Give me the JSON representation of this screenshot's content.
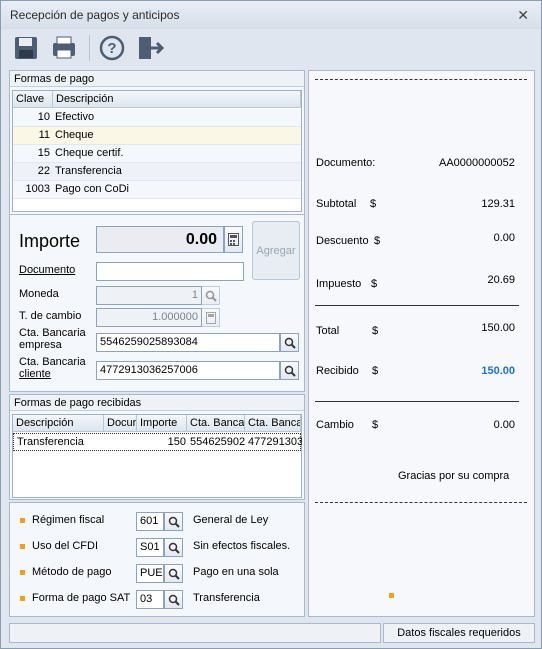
{
  "window": {
    "title": "Recepción de pagos y anticipos"
  },
  "toolbar": {
    "icons": [
      "save-icon",
      "print-icon",
      "help-icon",
      "exit-icon"
    ]
  },
  "formas_pago": {
    "header": "Formas de pago",
    "columns": [
      "Clave",
      "Descripción"
    ],
    "rows": [
      {
        "clave": "10",
        "desc": "Efectivo"
      },
      {
        "clave": "11",
        "desc": "Cheque"
      },
      {
        "clave": "15",
        "desc": "Cheque certif."
      },
      {
        "clave": "22",
        "desc": "Transferencia"
      },
      {
        "clave": "1003",
        "desc": "Pago con CoDi"
      }
    ]
  },
  "form": {
    "importe_label": "Importe",
    "importe_value": "0.00",
    "agregar": "Agregar",
    "documento_label": "Documento",
    "documento_value": "",
    "moneda_label": "Moneda",
    "moneda_value": "1",
    "tcambio_label": "T. de cambio",
    "tcambio_value": "1.000000",
    "cta_empresa_label1": "Cta. Bancaria",
    "cta_empresa_label2": "empresa",
    "cta_empresa_value": "5546259025893084",
    "cta_cliente_label1": "Cta. Bancaria",
    "cta_cliente_label2": "cliente",
    "cta_cliente_value": "4772913036257006"
  },
  "recibidas": {
    "header": "Formas de pago recibidas",
    "columns": [
      "Descripción",
      "Docur",
      "Importe",
      "Cta. Banca",
      "Cta. Banca"
    ],
    "rows": [
      {
        "desc": "Transferencia",
        "doc": "",
        "importe": "150",
        "cta1": "554625902",
        "cta2": "477291303"
      }
    ]
  },
  "fiscal": [
    {
      "label": "Régimen fiscal",
      "code": "601",
      "desc": "General de Ley"
    },
    {
      "label": "Uso del CFDI",
      "code": "S01",
      "desc": "Sin efectos fiscales."
    },
    {
      "label": "Método de pago",
      "code": "PUE",
      "desc": "Pago en una sola"
    },
    {
      "label": "Forma de pago SAT",
      "code": "03",
      "desc": "Transferencia"
    }
  ],
  "receipt": {
    "documento_label": "Documento:",
    "documento_value": "AA0000000052",
    "subtotal_label": "Subtotal",
    "subtotal_value": "129.31",
    "descuento_label": "Descuento",
    "descuento_value": "0.00",
    "impuesto_label": "Impuesto",
    "impuesto_value": "20.69",
    "total_label": "Total",
    "total_value": "150.00",
    "recibido_label": "Recibido",
    "recibido_value": "150.00",
    "cambio_label": "Cambio",
    "cambio_value": "0.00",
    "currency": "$",
    "gracias": "Gracias por su compra"
  },
  "status": {
    "right": "Datos fiscales requeridos"
  },
  "colors": {
    "accent": "#1f6fd0",
    "marker": "#f0a020"
  }
}
